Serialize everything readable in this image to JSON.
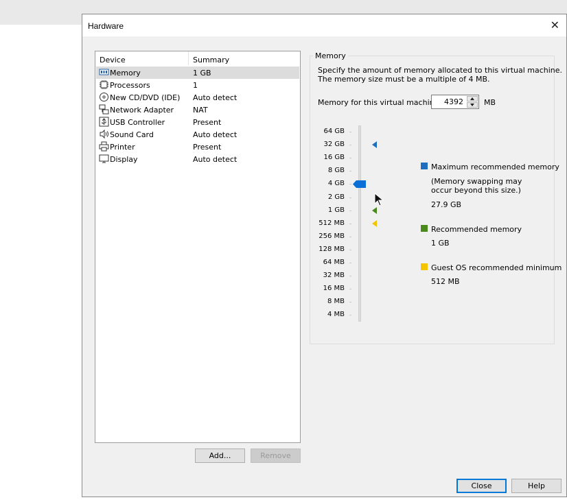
{
  "window": {
    "title": "Hardware"
  },
  "device_list": {
    "headers": {
      "device": "Device",
      "summary": "Summary"
    },
    "items": [
      {
        "name": "Memory",
        "summary": "1 GB",
        "icon": "memory-icon",
        "selected": true
      },
      {
        "name": "Processors",
        "summary": "1",
        "icon": "processor-icon"
      },
      {
        "name": "New CD/DVD (IDE)",
        "summary": "Auto detect",
        "icon": "cd-dvd-icon"
      },
      {
        "name": "Network Adapter",
        "summary": "NAT",
        "icon": "network-icon"
      },
      {
        "name": "USB Controller",
        "summary": "Present",
        "icon": "usb-icon"
      },
      {
        "name": "Sound Card",
        "summary": "Auto detect",
        "icon": "speaker-icon"
      },
      {
        "name": "Printer",
        "summary": "Present",
        "icon": "printer-icon"
      },
      {
        "name": "Display",
        "summary": "Auto detect",
        "icon": "monitor-icon"
      }
    ],
    "add_label": "Add...",
    "remove_label": "Remove"
  },
  "memory": {
    "group_title": "Memory",
    "description_line1": "Specify the amount of memory allocated to this virtual machine.",
    "description_line2": "The memory size must be a multiple of 4 MB.",
    "field_label": "Memory for this virtual machine:",
    "value": "4392",
    "unit": "MB",
    "scale_labels": [
      "64 GB",
      "32 GB",
      "16 GB",
      "8 GB",
      "4 GB",
      "2 GB",
      "1 GB",
      "512 MB",
      "256 MB",
      "128 MB",
      "64 MB",
      "32 MB",
      "16 MB",
      "8 MB",
      "4 MB"
    ],
    "slider_value": "4 GB",
    "markers": [
      {
        "label": "32 GB",
        "color": "#1f6fbf"
      },
      {
        "label": "1 GB",
        "color": "#4a8a1c"
      },
      {
        "label": "512 MB",
        "color": "#f2c500"
      }
    ],
    "legend": {
      "max": {
        "title": "Maximum recommended memory",
        "note_line1": "(Memory swapping may",
        "note_line2": "occur beyond this size.)",
        "value": "27.9 GB",
        "color": "#1f6fbf"
      },
      "recommended": {
        "title": "Recommended memory",
        "value": "1 GB",
        "color": "#4a8a1c"
      },
      "minimum": {
        "title": "Guest OS recommended minimum",
        "value": "512 MB",
        "color": "#f2c500"
      }
    }
  },
  "footer": {
    "close_label": "Close",
    "help_label": "Help"
  },
  "colors": {
    "accent": "#0078d7",
    "slider_thumb": "#0a6fd6",
    "selected_row": "#dcdcdc"
  }
}
